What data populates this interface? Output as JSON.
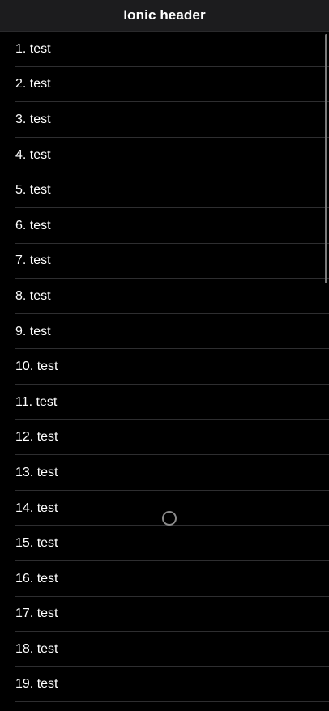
{
  "header": {
    "title": "Ionic header"
  },
  "list": {
    "items": [
      "1. test",
      "2. test",
      "3. test",
      "4. test",
      "5. test",
      "6. test",
      "7. test",
      "8. test",
      "9. test",
      "10. test",
      "11. test",
      "12. test",
      "13. test",
      "14. test",
      "15. test",
      "16. test",
      "17. test",
      "18. test",
      "19. test"
    ]
  },
  "colors": {
    "background": "#000000",
    "header_background": "#1c1c1e",
    "text": "#ffffff",
    "divider": "#2e2e30"
  },
  "icons": {
    "pointer": "touch-pointer-icon"
  }
}
